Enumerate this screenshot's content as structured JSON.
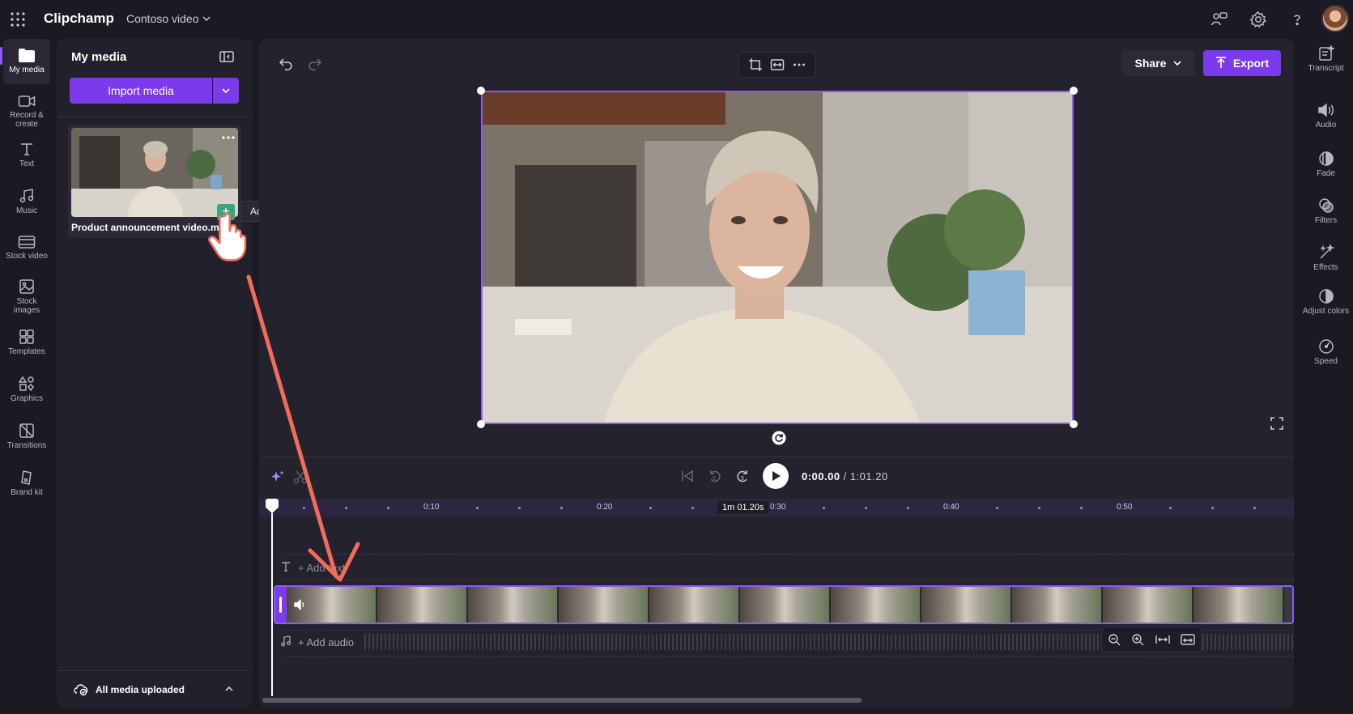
{
  "app": {
    "title": "Clipchamp",
    "project_name": "Contoso video",
    "avatar_icon": "avatar"
  },
  "left_rail": {
    "items": [
      {
        "label": "My media",
        "icon": "folder-icon",
        "active": true
      },
      {
        "label": "Record & create",
        "icon": "camera-icon"
      },
      {
        "label": "Text",
        "icon": "text-icon"
      },
      {
        "label": "Music",
        "icon": "music-icon"
      },
      {
        "label": "Stock video",
        "icon": "film-icon"
      },
      {
        "label": "Stock images",
        "icon": "image-icon"
      },
      {
        "label": "Templates",
        "icon": "templates-icon"
      },
      {
        "label": "Graphics",
        "icon": "shapes-icon"
      },
      {
        "label": "Transitions",
        "icon": "transitions-icon"
      },
      {
        "label": "Brand kit",
        "icon": "brand-icon"
      }
    ]
  },
  "media_panel": {
    "title": "My media",
    "import_label": "Import media",
    "file_name": "Product announcement video.mp4",
    "tooltip": "Add to timeline",
    "add_symbol": "+",
    "status": "All media uploaded"
  },
  "editor": {
    "share_label": "Share",
    "export_label": "Export"
  },
  "timeline": {
    "current_time": "0:00.00",
    "total_time": "/ 1:01.20",
    "skip_back_label": "5",
    "skip_forward_label": "5",
    "duration_badge": "1m 01.20s",
    "ticks": [
      "0:10",
      "0:20",
      "0:30",
      "0:40",
      "0:50"
    ],
    "add_text": "+ Add text",
    "add_audio": "+ Add audio"
  },
  "right_rail": {
    "items": [
      {
        "label": "Transcript",
        "icon": "transcript-icon"
      },
      {
        "label": "Audio",
        "icon": "speaker-icon"
      },
      {
        "label": "Fade",
        "icon": "fade-icon"
      },
      {
        "label": "Filters",
        "icon": "filters-icon"
      },
      {
        "label": "Effects",
        "icon": "wand-icon"
      },
      {
        "label": "Adjust colors",
        "icon": "contrast-icon"
      },
      {
        "label": "Speed",
        "icon": "gauge-icon"
      }
    ]
  },
  "colors": {
    "accent": "#7c3aed",
    "selection": "#8b5cf6",
    "annotation": "#f26b5b",
    "add_button": "#3aa37f"
  }
}
